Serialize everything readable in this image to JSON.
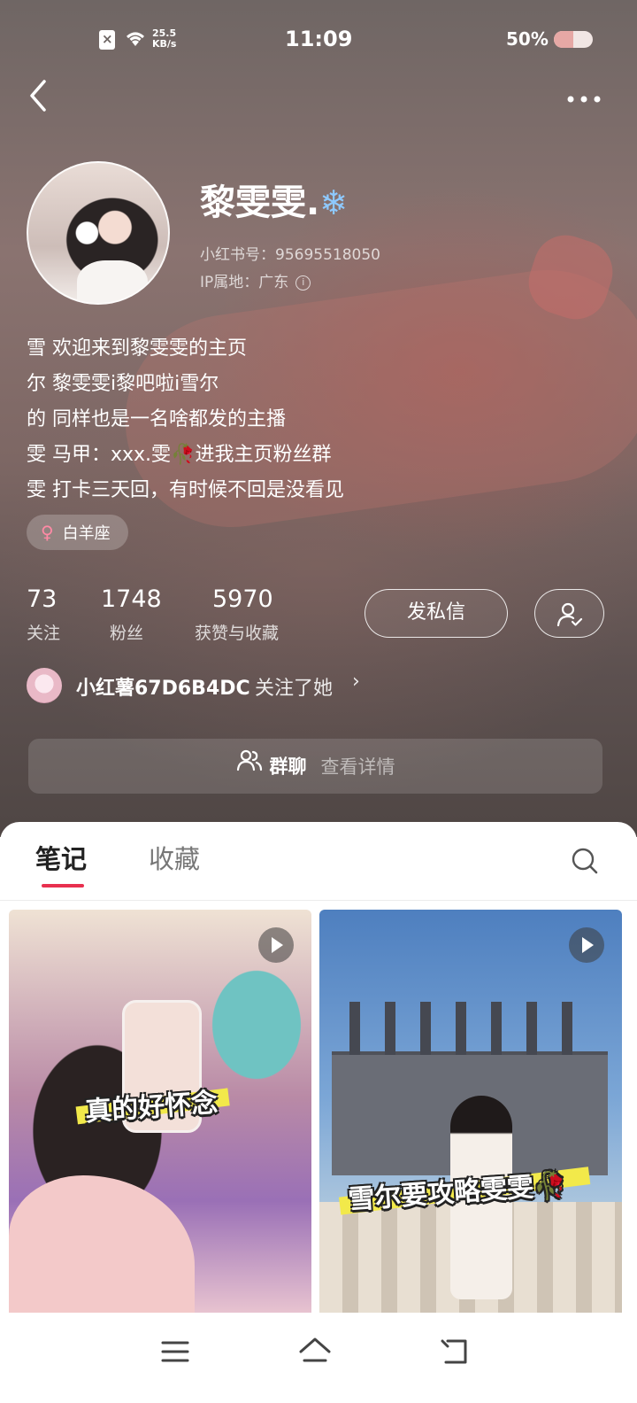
{
  "status_bar": {
    "network_speed_value": "25.5",
    "network_speed_unit": "KB/s",
    "time": "11:09",
    "battery_percent": "50%",
    "battery_level": 0.5,
    "icons": [
      "no-sim-icon",
      "wifi-icon",
      "battery-icon"
    ]
  },
  "header": {
    "back_icon": "back-chevron-icon",
    "more_icon": "more-dots-icon"
  },
  "profile": {
    "name": "黎雯雯.",
    "name_emoji": "❄",
    "red_id": "小红书号：95695518050",
    "ip_location": "IP属地：广东",
    "bio_lines": [
      "雪 欢迎来到黎雯雯的主页",
      "尔 黎雯雯i黎吧啦i雪尔",
      "的 同样也是一名啥都发的主播",
      "雯 马甲：xxx.雯🥀进我主页粉丝群",
      "雯 打卡三天回，有时候不回是没看见"
    ],
    "tag_gender_icon": "female-icon",
    "tag_label": "白羊座"
  },
  "stats": {
    "following": {
      "value": "73",
      "label": "关注"
    },
    "followers": {
      "value": "1748",
      "label": "粉丝"
    },
    "likes": {
      "value": "5970",
      "label": "获赞与收藏"
    }
  },
  "actions": {
    "message_label": "发私信",
    "follow_icon": "user-check-icon"
  },
  "mutual_follow": {
    "user_name": "小红薯67D6B4DC",
    "text": "关注了她",
    "chevron": "›"
  },
  "group_chat": {
    "label": "群聊",
    "detail": "查看详情",
    "icon": "group-icon"
  },
  "tabs": {
    "notes": "笔记",
    "collections": "收藏",
    "search_icon": "search-icon"
  },
  "notes": [
    {
      "caption": "真的好怀念",
      "type": "video"
    },
    {
      "caption": "雪尔要攻略雯雯🥀",
      "type": "video"
    }
  ],
  "nav_bar": {
    "icons": [
      "menu-icon",
      "home-icon",
      "back-icon"
    ]
  },
  "colors": {
    "accent": "#e8304f",
    "hero_base": "#7d6764",
    "caption_highlight": "#f2e94a"
  }
}
